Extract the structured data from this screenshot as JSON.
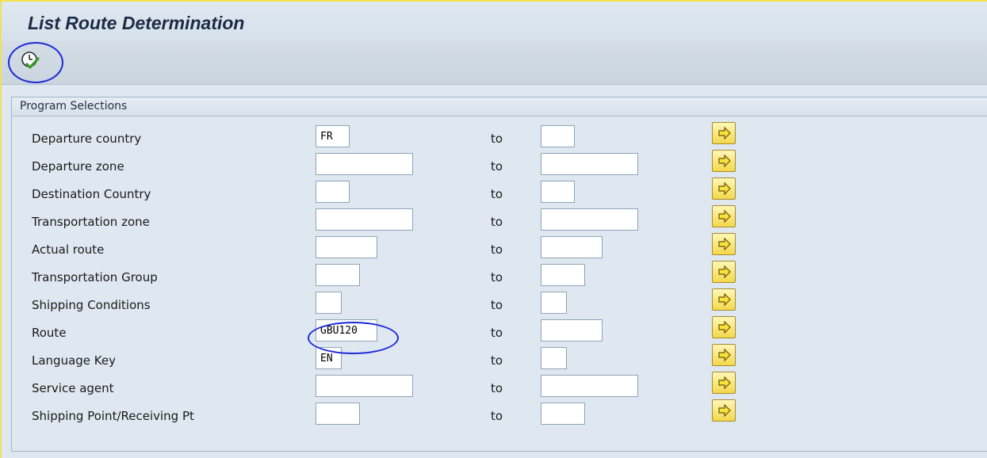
{
  "app": {
    "title": "List Route Determination"
  },
  "toolbar": {
    "execute_icon": "execute-clock-check-icon"
  },
  "section": {
    "title": "Program Selections",
    "to_label": "to",
    "multiple_selection_icon": "arrow-right-icon",
    "rows": [
      {
        "label": "Departure country",
        "low": "FR",
        "high": ""
      },
      {
        "label": "Departure zone",
        "low": "",
        "high": ""
      },
      {
        "label": "Destination Country",
        "low": "",
        "high": ""
      },
      {
        "label": "Transportation zone",
        "low": "",
        "high": ""
      },
      {
        "label": "Actual route",
        "low": "",
        "high": ""
      },
      {
        "label": "Transportation Group",
        "low": "",
        "high": ""
      },
      {
        "label": "Shipping Conditions",
        "low": "",
        "high": ""
      },
      {
        "label": "Route",
        "low": "GBU120",
        "high": ""
      },
      {
        "label": "Language Key",
        "low": "EN",
        "high": ""
      },
      {
        "label": "Service agent",
        "low": "",
        "high": ""
      },
      {
        "label": "Shipping Point/Receiving Pt",
        "low": "",
        "high": ""
      }
    ]
  },
  "colors": {
    "background": "#dfe8f1",
    "annotation": "#1d2ad8",
    "button_yellow": "#f3d84a"
  }
}
